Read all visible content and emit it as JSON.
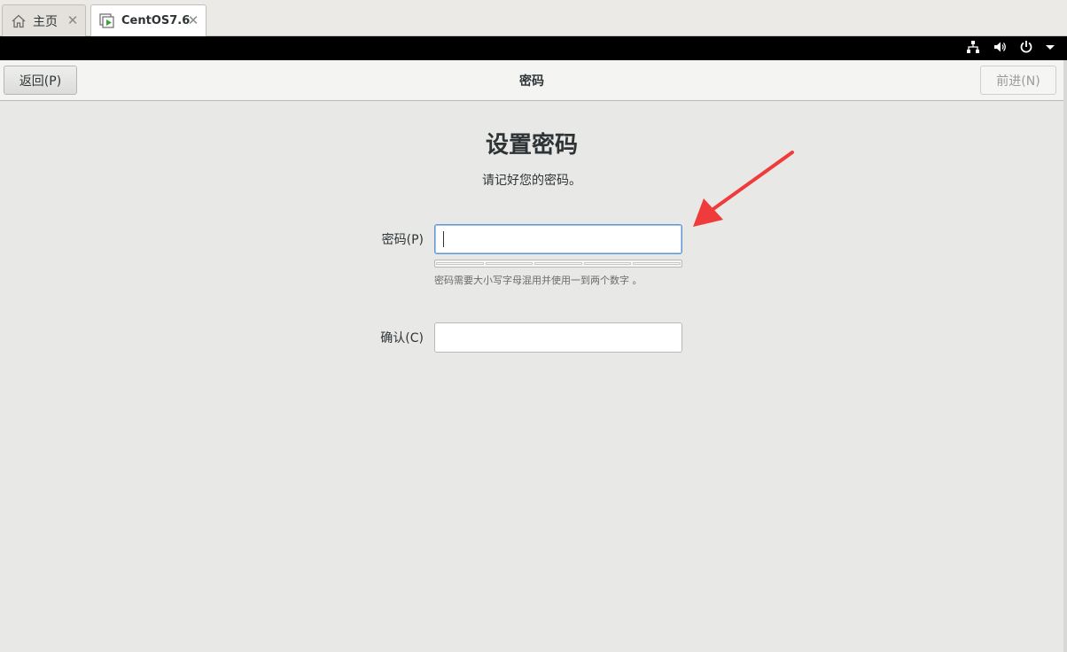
{
  "tabs": [
    {
      "label": "主页",
      "icon": "home-icon",
      "active": false
    },
    {
      "label": "CentOS7.6",
      "icon": "vm-icon",
      "active": true
    }
  ],
  "tab_close_glyph": "✕",
  "panel": {
    "icons": [
      "network-icon",
      "volume-icon",
      "power-icon",
      "chevron-down-icon"
    ]
  },
  "header": {
    "back_label": "返回(P)",
    "title": "密码",
    "next_label": "前进(N)"
  },
  "form": {
    "title": "设置密码",
    "subtitle": "请记好您的密码。",
    "password_label": "密码(P)",
    "password_value": "",
    "strength_segments": 5,
    "strength_level": 0,
    "hint": "密码需要大小写字母混用并使用一到两个数字 。",
    "confirm_label": "确认(C)",
    "confirm_value": ""
  },
  "colors": {
    "accent": "#5f95d1",
    "arrow": "#ef3b3b"
  }
}
